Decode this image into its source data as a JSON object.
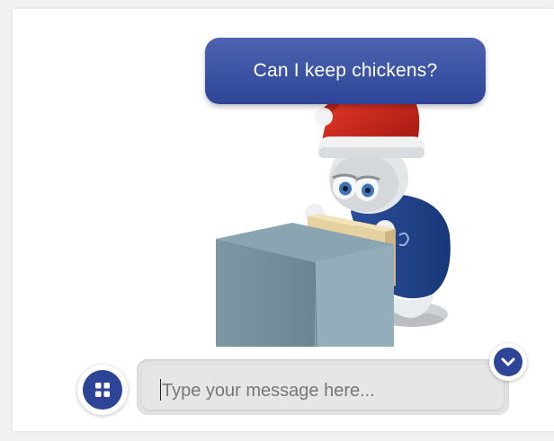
{
  "chat": {
    "user_message": "Can I keep chickens?"
  },
  "input": {
    "placeholder": "Type your message here...",
    "value": ""
  },
  "icons": {
    "menu": "grid-icon",
    "collapse": "chevron-down-icon"
  },
  "colors": {
    "accent": "#2e4597",
    "bubble_text": "#ffffff",
    "input_bg": "#e6e6e6"
  }
}
